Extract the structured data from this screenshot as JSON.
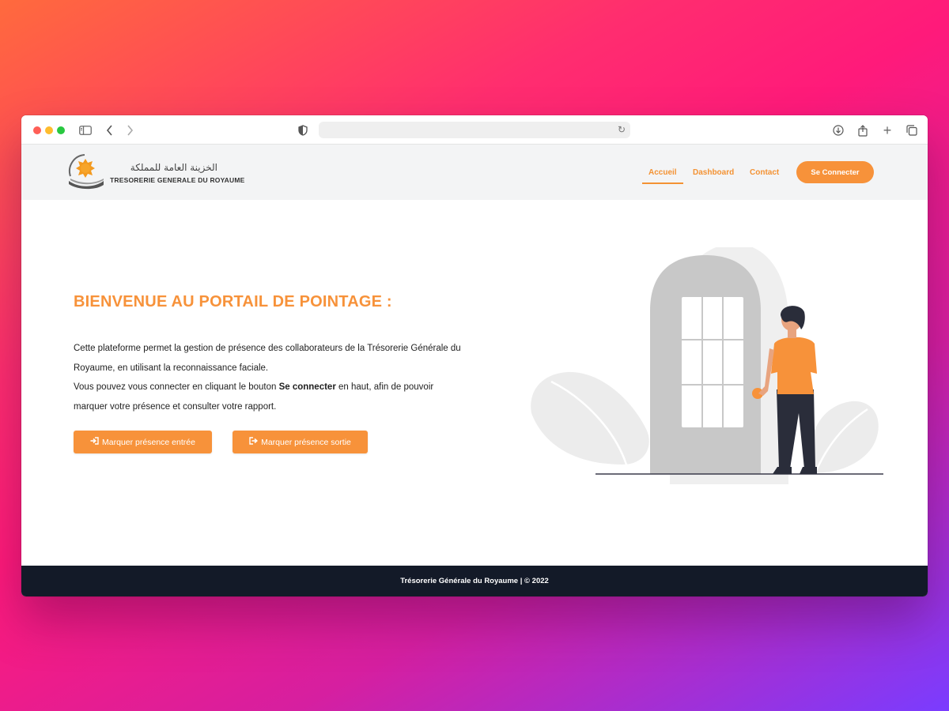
{
  "browser": {
    "url": ""
  },
  "header": {
    "logo_arabic": "الخزينة العامة للمملكة",
    "logo_latin": "TRESORERIE GENERALE DU ROYAUME",
    "nav": {
      "home": "Accueil",
      "dashboard": "Dashboard",
      "contact": "Contact"
    },
    "login_label": "Se Connecter",
    "accent_color": "#f7923a"
  },
  "hero": {
    "title": "BIENVENUE AU PORTAIL DE POINTAGE :",
    "paragraph_1": "Cette plateforme permet la gestion de présence des collaborateurs de la Trésorerie Générale du Royaume, en utilisant la reconnaissance faciale.",
    "paragraph_2_start": "Vous pouvez vous connecter en cliquant le bouton ",
    "paragraph_2_bold": "Se connecter",
    "paragraph_2_end": " en haut, afin de pouvoir marquer votre présence et consulter votre rapport.",
    "entry_button": "Marquer présence entrée",
    "exit_button": "Marquer présence sortie"
  },
  "footer": {
    "text": "Trésorerie Générale du Royaume | © 2022"
  }
}
